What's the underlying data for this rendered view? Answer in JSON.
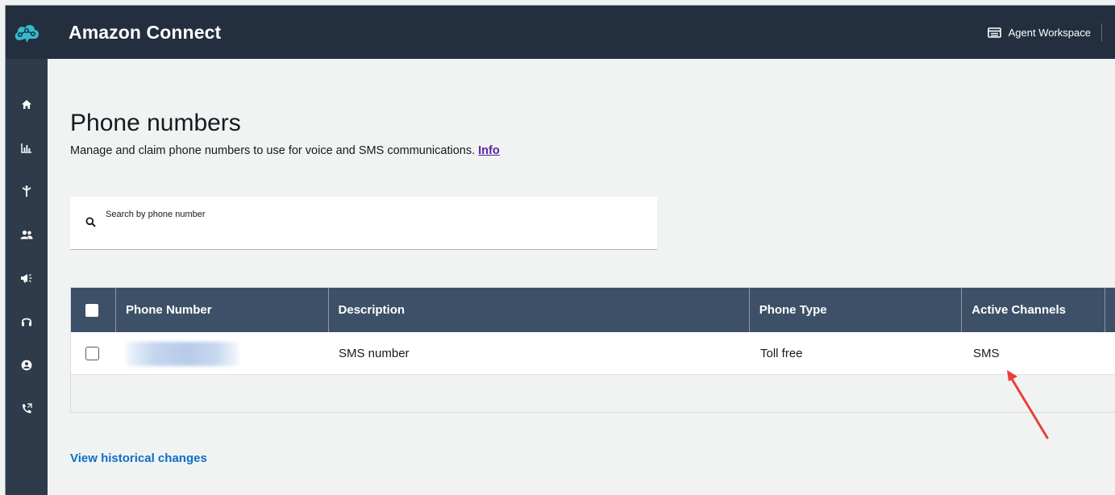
{
  "header": {
    "app_title": "Amazon Connect",
    "agent_workspace_label": "Agent Workspace",
    "logo_icon": "amazon-connect-cloud-logo",
    "background_color": "#232f3e"
  },
  "sidebar": {
    "background_color": "#2e3b4a",
    "items": [
      {
        "icon": "home-icon"
      },
      {
        "icon": "analytics-icon"
      },
      {
        "icon": "routing-icon"
      },
      {
        "icon": "users-icon"
      },
      {
        "icon": "campaigns-icon"
      },
      {
        "icon": "headset-icon"
      },
      {
        "icon": "profile-icon"
      },
      {
        "icon": "phone-icon"
      }
    ]
  },
  "page": {
    "title": "Phone numbers",
    "description": "Manage and claim phone numbers to use for voice and SMS communications.",
    "info_link": "Info"
  },
  "search": {
    "placeholder": "Search by phone number",
    "value": ""
  },
  "table": {
    "header_color": "#3d5068",
    "columns": [
      "Phone Number",
      "Description",
      "Phone Type",
      "Active Channels"
    ],
    "rows": [
      {
        "phone_number": "",
        "phone_number_redacted": true,
        "description": "SMS number",
        "phone_type": "Toll free",
        "active_channels": "SMS",
        "selected": false
      }
    ]
  },
  "annotation": {
    "color": "#e8403a",
    "points_to": "active_channels"
  },
  "footer": {
    "view_history_link": "View historical changes",
    "link_color": "#0a6fc4"
  }
}
